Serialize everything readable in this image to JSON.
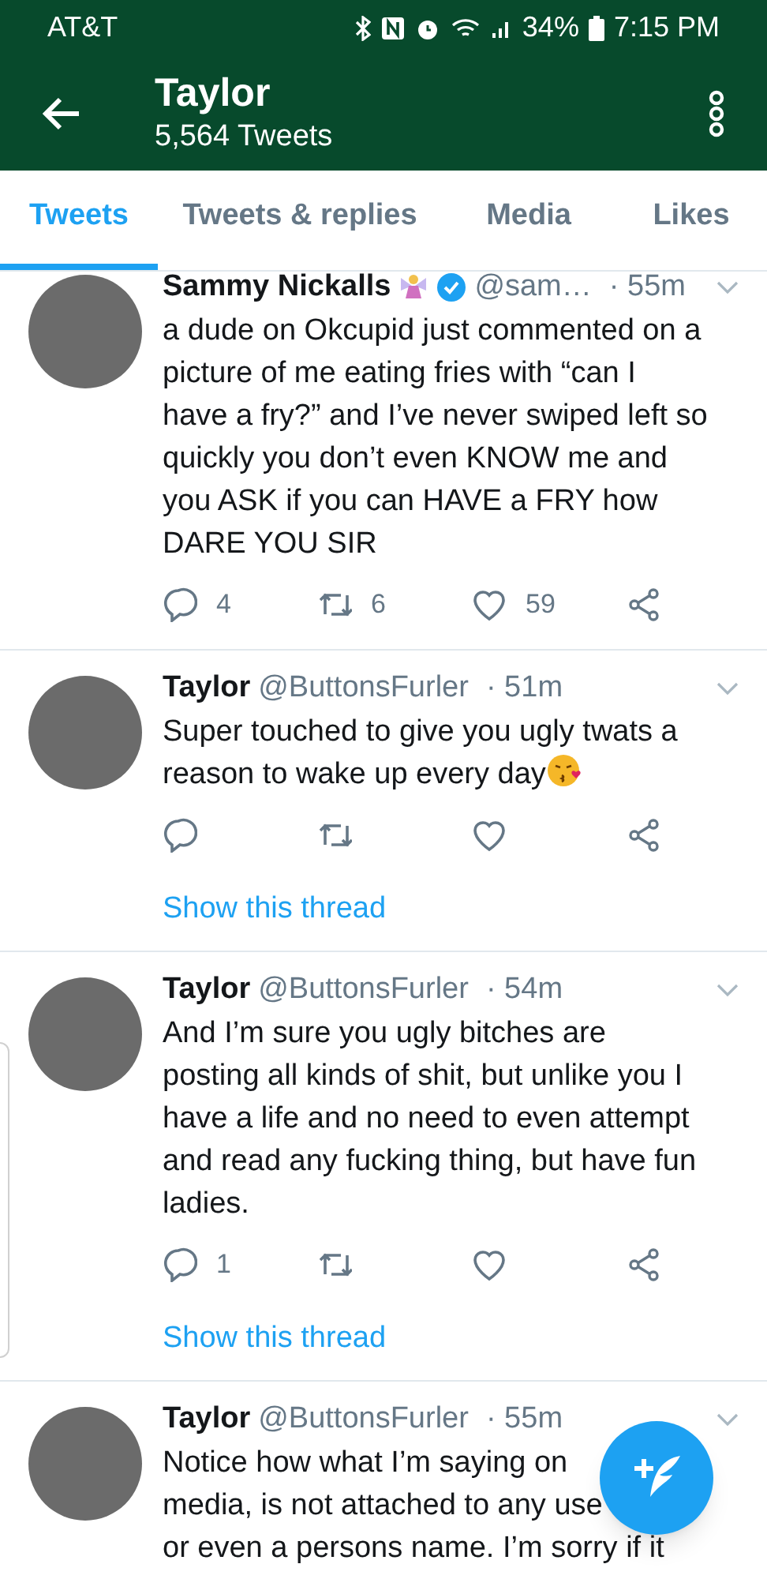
{
  "status_bar": {
    "carrier": "AT&T",
    "battery": "34%",
    "time": "7:15 PM"
  },
  "header": {
    "title": "Taylor",
    "subtitle": "5,564 Tweets"
  },
  "tabs": [
    {
      "label": "Tweets",
      "selected": true
    },
    {
      "label": "Tweets & replies",
      "selected": false
    },
    {
      "label": "Media",
      "selected": false
    },
    {
      "label": "Likes",
      "selected": false
    }
  ],
  "tweets": [
    {
      "name": "Sammy Nickalls",
      "emoji_after_name": true,
      "verified": true,
      "handle": "@sam…",
      "time": "· 55m",
      "text_lines": [
        "a dude on Okcupid just commented on a",
        "picture of me eating fries with “can I",
        "have a fry?” and I’ve never swiped left so",
        "quickly you don’t even KNOW me and",
        "you ASK if you can HAVE a FRY how",
        "DARE YOU SIR"
      ],
      "replies": "4",
      "retweets": "6",
      "likes": "59"
    },
    {
      "name": "Taylor",
      "handle": "@ButtonsFurler",
      "time": "· 51m",
      "text_lines": [
        "Super touched to give you ugly twats a",
        "reason to wake up every day"
      ],
      "ends_with_emoji": true,
      "show_thread": "Show this thread"
    },
    {
      "name": "Taylor",
      "handle": "@ButtonsFurler",
      "time": "· 54m",
      "text_lines": [
        "And I’m sure you ugly bitches are",
        "posting all kinds of shit, but unlike you I",
        "have a life and no need to even attempt",
        "and read any fucking thing, but have fun",
        "ladies."
      ],
      "replies": "1",
      "show_thread": "Show this thread"
    },
    {
      "name": "Taylor",
      "handle": "@ButtonsFurler",
      "time": "· 55m",
      "text_lines": [
        "Notice how what I’m saying on",
        "media, is not attached to any use",
        "or even a persons name. I’m sorry if it"
      ]
    }
  ]
}
